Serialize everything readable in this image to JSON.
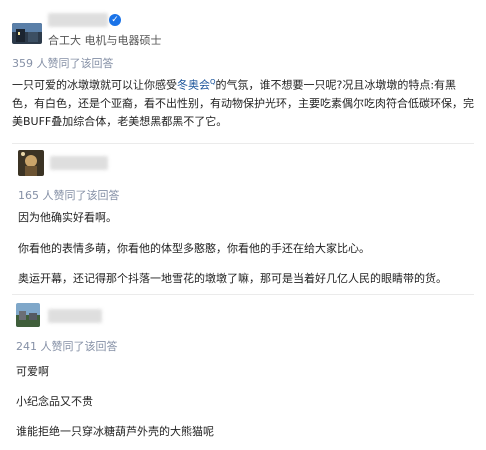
{
  "author1": {
    "subtitle": "合工大 电机与电器硕士"
  },
  "answer1": {
    "likes": "359 人赞同了该回答",
    "text_before_link": "一只可爱的冰墩墩就可以让你感受",
    "link_text": "冬奥会",
    "text_after_link": "的气氛，谁不想要一只呢?况且冰墩墩的特点:有黑色，有白色，还是个亚裔，看不出性别，有动物保护光环，主要吃素偶尔吃肉符合低碳环保，完美BUFF叠加综合体，老美想黑都黑不了它。"
  },
  "answer2": {
    "likes": "165 人赞同了该回答",
    "lines": [
      "因为他确实好看啊。",
      "你看他的表情多萌，你看他的体型多憨憨，你看他的手还在给大家比心。",
      "奥运开幕，还记得那个抖落一地雪花的墩墩了嘛，那可是当着好几亿人民的眼睛带的货。"
    ]
  },
  "answer3": {
    "likes": "241 人赞同了该回答",
    "lines": [
      "可爱啊",
      "小纪念品又不贵",
      "谁能拒绝一只穿冰糖葫芦外壳的大熊猫呢"
    ]
  },
  "icons": {
    "verified": "verified-badge-icon",
    "link_marker": "search-link-icon"
  },
  "colors": {
    "link": "#175199",
    "verified": "#1a73e8",
    "meta": "#8590a6"
  }
}
